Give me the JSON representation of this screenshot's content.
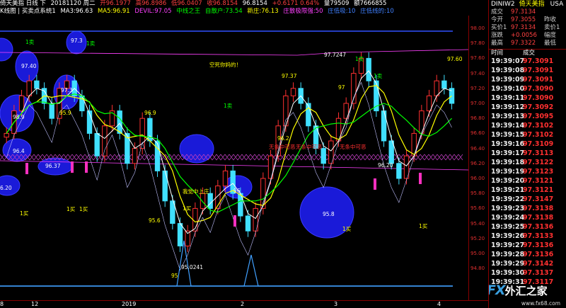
{
  "header": {
    "line1": [
      {
        "text": "倚天美指 日线 下",
        "color": "#ffffff"
      },
      {
        "text": "20181120 周二",
        "color": "#ffffff"
      },
      {
        "text": "开96.1977",
        "color": "#ff4040"
      },
      {
        "text": "高96.8986",
        "color": "#ff4040"
      },
      {
        "text": "低96.0407",
        "color": "#ff4040"
      },
      {
        "text": "收96.8154",
        "color": "#ff4040"
      },
      {
        "text": "96.8154",
        "color": "#ffffff"
      },
      {
        "text": "+0.6171 0.64%",
        "color": "#ff4040"
      },
      {
        "text": "量79509",
        "color": "#ffffff"
      },
      {
        "text": "额7666855",
        "color": "#ffffff"
      }
    ],
    "line2": [
      {
        "text": "K线图 | 买卖点系统1",
        "color": "#ffffff"
      },
      {
        "text": "MA3:96.63",
        "color": "#ffffff"
      },
      {
        "text": "MA5:96.91",
        "color": "#ffff00"
      },
      {
        "text": "DEVIL:97.05",
        "color": "#ff40ff"
      },
      {
        "text": "中线之王",
        "color": "#00ff00"
      },
      {
        "text": "自散户:73.54",
        "color": "#00ff00"
      },
      {
        "text": "新庄:76.13",
        "color": "#ffff00"
      },
      {
        "text": "庄散极限强:50",
        "color": "#ff40ff"
      },
      {
        "text": "庄低吸:10",
        "color": "#4080ff"
      },
      {
        "text": "庄低线的:10",
        "color": "#4080ff"
      }
    ]
  },
  "y_axis": {
    "ticks": [
      "98.00",
      "97.80",
      "97.60",
      "97.40",
      "97.20",
      "97.00",
      "96.80",
      "96.60",
      "96.40",
      "96.20",
      "96.00",
      "95.80",
      "95.60",
      "95.40",
      "95.20",
      "95.00",
      "94.80"
    ]
  },
  "x_axis": {
    "ticks": [
      {
        "label": "8",
        "at": 0
      },
      {
        "label": "12",
        "at": 44
      },
      {
        "label": "2019",
        "at": 172
      },
      {
        "label": "2",
        "at": 340
      },
      {
        "label": "3",
        "at": 472
      },
      {
        "label": "4",
        "at": 618
      }
    ]
  },
  "chart_labels": [
    {
      "text": "1卖",
      "color": "#00ff00"
    },
    {
      "text": "97.3",
      "color": "#ffffff"
    },
    {
      "text": "1卖",
      "color": "#00ff00"
    },
    {
      "text": "97.40",
      "color": "#ffffff"
    },
    {
      "text": "97.3",
      "color": "#ffffff"
    },
    {
      "text": "98.9",
      "color": "#ffffff"
    },
    {
      "text": "95.9",
      "color": "#ffff00"
    },
    {
      "text": "96.9",
      "color": "#ffff00"
    },
    {
      "text": "96.4",
      "color": "#ffffff"
    },
    {
      "text": "96.37",
      "color": "#ffffff"
    },
    {
      "text": "6.20",
      "color": "#ffffff"
    },
    {
      "text": "1买",
      "color": "#ffff00"
    },
    {
      "text": "1买",
      "color": "#ffff00"
    },
    {
      "text": "1买",
      "color": "#ffff00"
    },
    {
      "text": "95.6",
      "color": "#ffff00"
    },
    {
      "text": "我觉中上庄",
      "color": "#ffff00"
    },
    {
      "text": "96",
      "color": "#ffffff"
    },
    {
      "text": "1买",
      "color": "#ffff00"
    },
    {
      "text": "95.0241",
      "color": "#ffffff"
    },
    {
      "text": "95",
      "color": "#ffff00"
    },
    {
      "text": "空死你妈的！",
      "color": "#ffff00"
    },
    {
      "text": "1卖",
      "color": "#00ff00"
    },
    {
      "text": "97.37",
      "color": "#ffff00"
    },
    {
      "text": "96.2",
      "color": "#ffff00"
    },
    {
      "text": "无条中可恶",
      "color": "#ff3030"
    },
    {
      "text": "无条中可恶",
      "color": "#ff3030"
    },
    {
      "text": "无条中可恶",
      "color": "#ff3030"
    },
    {
      "text": "97.7247",
      "color": "#ffffff"
    },
    {
      "text": "1卖",
      "color": "#00ff00"
    },
    {
      "text": "97",
      "color": "#ffff00"
    },
    {
      "text": "1卖",
      "color": "#00ff00"
    },
    {
      "text": "96.20",
      "color": "#ffffff"
    },
    {
      "text": "95.8",
      "color": "#ffffff"
    },
    {
      "text": "1买",
      "color": "#ffff00"
    },
    {
      "text": "1买",
      "color": "#ffff00"
    },
    {
      "text": "97.60",
      "color": "#ffff00"
    }
  ],
  "quote_panel": {
    "code": "DINIW2",
    "name": "倚天美指",
    "code2": "USA",
    "rows": [
      {
        "label": "成交",
        "value": "97.3134",
        "label2": ""
      },
      {
        "label": "今开",
        "value": "97.3055",
        "label2": "昨收"
      },
      {
        "label": "买价1",
        "value": "97.3134",
        "label2": "卖价1"
      },
      {
        "label": "涨跌",
        "value": "+0.0056",
        "label2": "幅度"
      },
      {
        "label": "最高",
        "value": "97.3322",
        "label2": "最低"
      }
    ],
    "ticks_header": {
      "time": "时间",
      "price": "成交"
    },
    "ticks": [
      {
        "time": "19:39:07",
        "price": "97.3091"
      },
      {
        "time": "19:39:08",
        "price": "97.3091"
      },
      {
        "time": "19:39:09",
        "price": "97.3091"
      },
      {
        "time": "19:39:10",
        "price": "97.3090"
      },
      {
        "time": "19:39:11",
        "price": "97.3090"
      },
      {
        "time": "19:39:12",
        "price": "97.3092"
      },
      {
        "time": "19:39:13",
        "price": "97.3095"
      },
      {
        "time": "19:39:14",
        "price": "97.3102"
      },
      {
        "time": "19:39:15",
        "price": "97.3102"
      },
      {
        "time": "19:39:16",
        "price": "97.3109"
      },
      {
        "time": "19:39:17",
        "price": "97.3113"
      },
      {
        "time": "19:39:18",
        "price": "97.3122"
      },
      {
        "time": "19:39:19",
        "price": "97.3123"
      },
      {
        "time": "19:39:20",
        "price": "97.3121"
      },
      {
        "time": "19:39:21",
        "price": "97.3121"
      },
      {
        "time": "19:39:22",
        "price": "97.3147"
      },
      {
        "time": "19:39:23",
        "price": "97.3138"
      },
      {
        "time": "19:39:24",
        "price": "97.3138"
      },
      {
        "time": "19:39:25",
        "price": "97.3136"
      },
      {
        "time": "19:39:26",
        "price": "97.3133"
      },
      {
        "time": "19:39:27",
        "price": "97.3136"
      },
      {
        "time": "19:39:28",
        "price": "97.3136"
      },
      {
        "time": "19:39:29",
        "price": "97.3142"
      },
      {
        "time": "19:39:30",
        "price": "97.3137"
      },
      {
        "time": "19:39:31",
        "price": "97.3117"
      }
    ]
  },
  "watermark": {
    "logo": "FX",
    "logo2": "外汇之家",
    "url": "www.fx68.com"
  },
  "colors": {
    "up": "#ff3030",
    "down": "#40e0ff",
    "ma3": "#ffffff",
    "ma5": "#ffff00",
    "midline": "#00ff00",
    "accent": "#800000"
  }
}
